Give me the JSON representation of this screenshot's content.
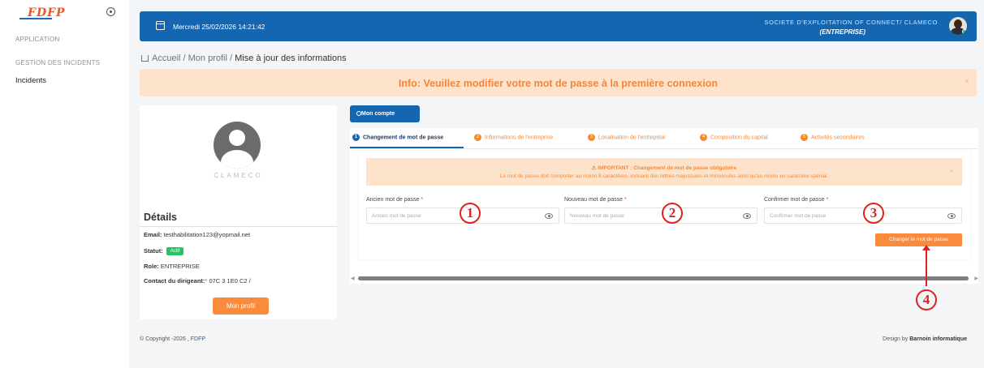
{
  "sidebar": {
    "logo": "FDFP",
    "sections": [
      {
        "label": "APPLICATION"
      },
      {
        "label": "GESTION DES INCIDENTS"
      }
    ],
    "items": [
      {
        "label": "Incidents"
      }
    ]
  },
  "topbar": {
    "datetime": "Mercredi 25/02/2026 14:21:42",
    "company": "SOCIETE D'EXPLOITATION OF CONNECT/ CLAMECO",
    "role": "(ENTREPRISE)"
  },
  "breadcrumb": {
    "home": "Accueil",
    "sep1": " / ",
    "profile": "Mon profil",
    "sep2": " / ",
    "current": "Mise à jour des informations"
  },
  "info_banner": {
    "text": "Info: Veuillez modifier votre mot de passe à la première connexion",
    "close": "×"
  },
  "profile": {
    "name": "CLAMECO",
    "details_title": "Détails",
    "email_label": "Email:",
    "email_value": "testhabilitation123@yopmail.net",
    "status_label": "Statut:",
    "status_value": "Actif",
    "role_label": "Role:",
    "role_value": "ENTREPRISE",
    "contact_label": "Contact du dirigeant:",
    "contact_req": "*",
    "contact_value": "07C 3 1E0 C2 /",
    "button": "Mon profil"
  },
  "account": {
    "button": "Mon compte",
    "tabs": [
      {
        "num": "1",
        "label": "Changement de mot de passe",
        "active": true
      },
      {
        "num": "2",
        "label": "Informations de l'entreprise",
        "active": false
      },
      {
        "num": "3",
        "label": "Localisation de l'entreprise",
        "active": false
      },
      {
        "num": "4",
        "label": "Composition du capital",
        "active": false
      },
      {
        "num": "5",
        "label": "Activités secondaires",
        "active": false
      }
    ]
  },
  "warning": {
    "title": "⚠ IMPORTANT : Changement de mot de passe obligatoire",
    "text": "Le mot de passe doit comporter au moins 8 caractères, incluant des lettres majuscules et minuscules ainsi qu'au moins un caractère spécial.",
    "close": "×"
  },
  "form": {
    "fields": [
      {
        "label": "Ancien mot de passe",
        "required": "*",
        "placeholder": "Ancien mot de passe",
        "marker": "1"
      },
      {
        "label": "Nouveau mot de passe",
        "required": "*",
        "placeholder": "Nouveau mot de passe",
        "marker": "2"
      },
      {
        "label": "Confirmer mot de passe",
        "required": "*",
        "placeholder": "Confirmer mot de passe",
        "marker": "3"
      }
    ],
    "submit": "Changer le mot de passe",
    "submit_marker": "4"
  },
  "footer": {
    "copyright": "© Copyright -2026 , ",
    "brand": "FDFP",
    "design_prefix": "Design by ",
    "design_company": "Barnoin informatique"
  },
  "colors": {
    "primary": "#1466b0",
    "accent": "#fb8b3c",
    "success": "#22c55e",
    "annotation": "#dd2222"
  }
}
